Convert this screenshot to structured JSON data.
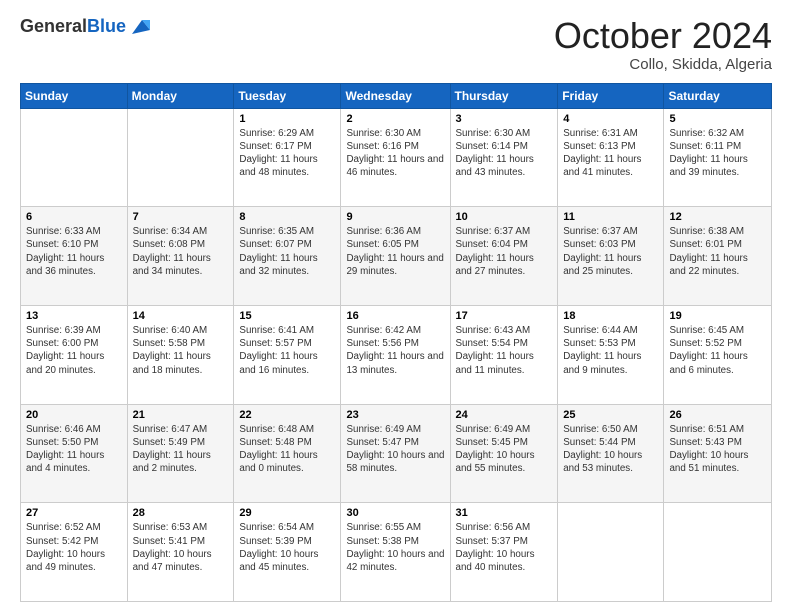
{
  "header": {
    "logo_general": "General",
    "logo_blue": "Blue",
    "month": "October 2024",
    "location": "Collo, Skidda, Algeria"
  },
  "weekdays": [
    "Sunday",
    "Monday",
    "Tuesday",
    "Wednesday",
    "Thursday",
    "Friday",
    "Saturday"
  ],
  "weeks": [
    [
      null,
      null,
      {
        "day": 1,
        "sunrise": "6:29 AM",
        "sunset": "6:17 PM",
        "daylight": "11 hours and 48 minutes."
      },
      {
        "day": 2,
        "sunrise": "6:30 AM",
        "sunset": "6:16 PM",
        "daylight": "11 hours and 46 minutes."
      },
      {
        "day": 3,
        "sunrise": "6:30 AM",
        "sunset": "6:14 PM",
        "daylight": "11 hours and 43 minutes."
      },
      {
        "day": 4,
        "sunrise": "6:31 AM",
        "sunset": "6:13 PM",
        "daylight": "11 hours and 41 minutes."
      },
      {
        "day": 5,
        "sunrise": "6:32 AM",
        "sunset": "6:11 PM",
        "daylight": "11 hours and 39 minutes."
      }
    ],
    [
      {
        "day": 6,
        "sunrise": "6:33 AM",
        "sunset": "6:10 PM",
        "daylight": "11 hours and 36 minutes."
      },
      {
        "day": 7,
        "sunrise": "6:34 AM",
        "sunset": "6:08 PM",
        "daylight": "11 hours and 34 minutes."
      },
      {
        "day": 8,
        "sunrise": "6:35 AM",
        "sunset": "6:07 PM",
        "daylight": "11 hours and 32 minutes."
      },
      {
        "day": 9,
        "sunrise": "6:36 AM",
        "sunset": "6:05 PM",
        "daylight": "11 hours and 29 minutes."
      },
      {
        "day": 10,
        "sunrise": "6:37 AM",
        "sunset": "6:04 PM",
        "daylight": "11 hours and 27 minutes."
      },
      {
        "day": 11,
        "sunrise": "6:37 AM",
        "sunset": "6:03 PM",
        "daylight": "11 hours and 25 minutes."
      },
      {
        "day": 12,
        "sunrise": "6:38 AM",
        "sunset": "6:01 PM",
        "daylight": "11 hours and 22 minutes."
      }
    ],
    [
      {
        "day": 13,
        "sunrise": "6:39 AM",
        "sunset": "6:00 PM",
        "daylight": "11 hours and 20 minutes."
      },
      {
        "day": 14,
        "sunrise": "6:40 AM",
        "sunset": "5:58 PM",
        "daylight": "11 hours and 18 minutes."
      },
      {
        "day": 15,
        "sunrise": "6:41 AM",
        "sunset": "5:57 PM",
        "daylight": "11 hours and 16 minutes."
      },
      {
        "day": 16,
        "sunrise": "6:42 AM",
        "sunset": "5:56 PM",
        "daylight": "11 hours and 13 minutes."
      },
      {
        "day": 17,
        "sunrise": "6:43 AM",
        "sunset": "5:54 PM",
        "daylight": "11 hours and 11 minutes."
      },
      {
        "day": 18,
        "sunrise": "6:44 AM",
        "sunset": "5:53 PM",
        "daylight": "11 hours and 9 minutes."
      },
      {
        "day": 19,
        "sunrise": "6:45 AM",
        "sunset": "5:52 PM",
        "daylight": "11 hours and 6 minutes."
      }
    ],
    [
      {
        "day": 20,
        "sunrise": "6:46 AM",
        "sunset": "5:50 PM",
        "daylight": "11 hours and 4 minutes."
      },
      {
        "day": 21,
        "sunrise": "6:47 AM",
        "sunset": "5:49 PM",
        "daylight": "11 hours and 2 minutes."
      },
      {
        "day": 22,
        "sunrise": "6:48 AM",
        "sunset": "5:48 PM",
        "daylight": "11 hours and 0 minutes."
      },
      {
        "day": 23,
        "sunrise": "6:49 AM",
        "sunset": "5:47 PM",
        "daylight": "10 hours and 58 minutes."
      },
      {
        "day": 24,
        "sunrise": "6:49 AM",
        "sunset": "5:45 PM",
        "daylight": "10 hours and 55 minutes."
      },
      {
        "day": 25,
        "sunrise": "6:50 AM",
        "sunset": "5:44 PM",
        "daylight": "10 hours and 53 minutes."
      },
      {
        "day": 26,
        "sunrise": "6:51 AM",
        "sunset": "5:43 PM",
        "daylight": "10 hours and 51 minutes."
      }
    ],
    [
      {
        "day": 27,
        "sunrise": "6:52 AM",
        "sunset": "5:42 PM",
        "daylight": "10 hours and 49 minutes."
      },
      {
        "day": 28,
        "sunrise": "6:53 AM",
        "sunset": "5:41 PM",
        "daylight": "10 hours and 47 minutes."
      },
      {
        "day": 29,
        "sunrise": "6:54 AM",
        "sunset": "5:39 PM",
        "daylight": "10 hours and 45 minutes."
      },
      {
        "day": 30,
        "sunrise": "6:55 AM",
        "sunset": "5:38 PM",
        "daylight": "10 hours and 42 minutes."
      },
      {
        "day": 31,
        "sunrise": "6:56 AM",
        "sunset": "5:37 PM",
        "daylight": "10 hours and 40 minutes."
      },
      null,
      null
    ]
  ],
  "labels": {
    "sunrise_prefix": "Sunrise: ",
    "sunset_prefix": "Sunset: ",
    "daylight_prefix": "Daylight: "
  }
}
